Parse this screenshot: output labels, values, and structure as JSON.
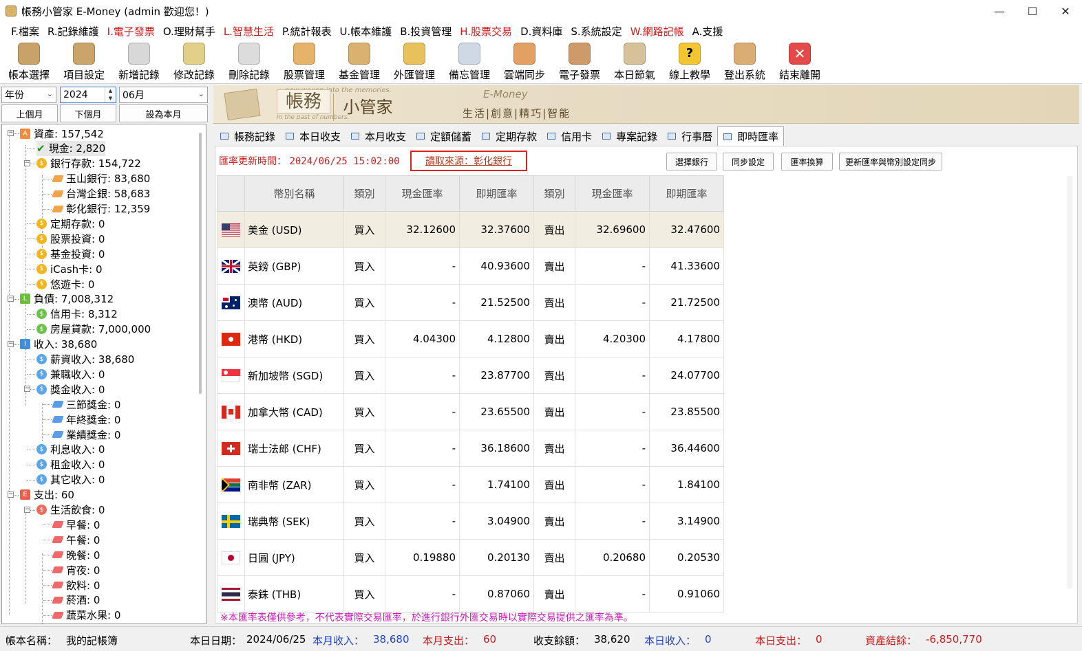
{
  "window": {
    "title": "帳務小管家 E-Money (admin 歡迎您！)"
  },
  "menu": [
    {
      "label": "F.檔案",
      "red": false
    },
    {
      "label": "R.記錄維護",
      "red": false
    },
    {
      "label": "I.電子發票",
      "red": true
    },
    {
      "label": "O.理財幫手",
      "red": false
    },
    {
      "label": "L.智慧生活",
      "red": true
    },
    {
      "label": "P.統計報表",
      "red": false
    },
    {
      "label": "U.帳本維護",
      "red": false
    },
    {
      "label": "B.投資管理",
      "red": false
    },
    {
      "label": "H.股票交易",
      "red": true
    },
    {
      "label": "D.資料庫",
      "red": false
    },
    {
      "label": "S.系統設定",
      "red": false
    },
    {
      "label": "W.網路記帳",
      "red": true
    },
    {
      "label": "A.支援",
      "red": false
    }
  ],
  "toolbar": [
    {
      "label": "帳本選擇",
      "icon": "ledger-book-icon",
      "color": "#c9a26a"
    },
    {
      "label": "項目設定",
      "icon": "settings-gear-icon",
      "color": "#caa56b"
    },
    {
      "label": "新增記錄",
      "icon": "add-record-icon",
      "color": "#d8d8d8"
    },
    {
      "label": "修改記錄",
      "icon": "edit-record-icon",
      "color": "#e2cf8a"
    },
    {
      "label": "刪除記錄",
      "icon": "delete-record-icon",
      "color": "#dcdcdc"
    },
    {
      "label": "股票管理",
      "icon": "stock-chart-icon",
      "color": "#e6b36a"
    },
    {
      "label": "基金管理",
      "icon": "fund-bank-icon",
      "color": "#d9b272"
    },
    {
      "label": "外匯管理",
      "icon": "forex-coin-icon",
      "color": "#e9c15c"
    },
    {
      "label": "備忘管理",
      "icon": "memo-icon",
      "color": "#cfd9e6"
    },
    {
      "label": "雲端同步",
      "icon": "cloud-sync-icon",
      "color": "#e2a062"
    },
    {
      "label": "電子發票",
      "icon": "qr-invoice-icon",
      "color": "#cf9a6a"
    },
    {
      "label": "本日節氣",
      "icon": "solar-term-icon",
      "color": "#d6c29a"
    },
    {
      "label": "線上教學",
      "icon": "help-question-icon",
      "color": "#f2c531"
    },
    {
      "label": "登出系統",
      "icon": "logout-user-icon",
      "color": "#d9ad74"
    },
    {
      "label": "結束離開",
      "icon": "exit-close-icon",
      "color": "#e44a4a"
    }
  ],
  "filter": {
    "period_type": "年份",
    "year": "2024",
    "month": "06月",
    "prev_month": "上個月",
    "next_month": "下個月",
    "this_month": "設為本月"
  },
  "tree": [
    {
      "label": "資產: 157,542",
      "level": 0,
      "kind": "badge",
      "badge": "A",
      "color": "#f08a3c",
      "expanded": true
    },
    {
      "label": "現金: 2,820",
      "level": 1,
      "kind": "check",
      "selected": true
    },
    {
      "label": "銀行存款: 154,722",
      "level": 1,
      "kind": "coin",
      "coin": "$",
      "color": "#f3b51b",
      "expanded": true
    },
    {
      "label": "玉山銀行: 83,680",
      "level": 2,
      "kind": "gem",
      "color": "#f0a54a"
    },
    {
      "label": "台灣企銀: 58,683",
      "level": 2,
      "kind": "gem",
      "color": "#f0a54a"
    },
    {
      "label": "彰化銀行: 12,359",
      "level": 2,
      "kind": "gem",
      "color": "#f0a54a"
    },
    {
      "label": "定期存款: 0",
      "level": 1,
      "kind": "coin",
      "coin": "$",
      "color": "#f3b51b"
    },
    {
      "label": "股票投資: 0",
      "level": 1,
      "kind": "coin",
      "coin": "$",
      "color": "#f3b51b"
    },
    {
      "label": "基金投資: 0",
      "level": 1,
      "kind": "coin",
      "coin": "$",
      "color": "#f3b51b"
    },
    {
      "label": "iCash卡: 0",
      "level": 1,
      "kind": "coin",
      "coin": "$",
      "color": "#f3b51b"
    },
    {
      "label": "悠遊卡: 0",
      "level": 1,
      "kind": "coin",
      "coin": "$",
      "color": "#f3b51b"
    },
    {
      "label": "負債: 7,008,312",
      "level": 0,
      "kind": "badge",
      "badge": "L",
      "color": "#6cbf3a",
      "expanded": true
    },
    {
      "label": "信用卡: 8,312",
      "level": 1,
      "kind": "coin",
      "coin": "$",
      "color": "#6cc24a"
    },
    {
      "label": "房屋貸款: 7,000,000",
      "level": 1,
      "kind": "coin",
      "coin": "$",
      "color": "#6cc24a"
    },
    {
      "label": "收入: 38,680",
      "level": 0,
      "kind": "badge",
      "badge": "I",
      "color": "#3f8fe0",
      "expanded": true
    },
    {
      "label": "薪資收入: 38,680",
      "level": 1,
      "kind": "coin",
      "coin": "$",
      "color": "#5aa6ea"
    },
    {
      "label": "兼職收入: 0",
      "level": 1,
      "kind": "coin",
      "coin": "$",
      "color": "#5aa6ea"
    },
    {
      "label": "獎金收入: 0",
      "level": 1,
      "kind": "coin",
      "coin": "$",
      "color": "#5aa6ea",
      "expanded": true
    },
    {
      "label": "三節獎金: 0",
      "level": 2,
      "kind": "gem",
      "color": "#5a9de6"
    },
    {
      "label": "年終獎金: 0",
      "level": 2,
      "kind": "gem",
      "color": "#5a9de6"
    },
    {
      "label": "業績獎金: 0",
      "level": 2,
      "kind": "gem",
      "color": "#5a9de6"
    },
    {
      "label": "利息收入: 0",
      "level": 1,
      "kind": "coin",
      "coin": "$",
      "color": "#5aa6ea"
    },
    {
      "label": "租金收入: 0",
      "level": 1,
      "kind": "coin",
      "coin": "$",
      "color": "#5aa6ea"
    },
    {
      "label": "其它收入: 0",
      "level": 1,
      "kind": "coin",
      "coin": "$",
      "color": "#5aa6ea"
    },
    {
      "label": "支出: 60",
      "level": 0,
      "kind": "badge",
      "badge": "E",
      "color": "#e8604a",
      "expanded": true
    },
    {
      "label": "生活飲食: 0",
      "level": 1,
      "kind": "coin",
      "coin": "$",
      "color": "#ee6a5a",
      "expanded": true
    },
    {
      "label": "早餐: 0",
      "level": 2,
      "kind": "gem",
      "color": "#ee6a6a"
    },
    {
      "label": "午餐: 0",
      "level": 2,
      "kind": "gem",
      "color": "#ee6a6a"
    },
    {
      "label": "晚餐: 0",
      "level": 2,
      "kind": "gem",
      "color": "#ee6a6a"
    },
    {
      "label": "宵夜: 0",
      "level": 2,
      "kind": "gem",
      "color": "#ee6a6a"
    },
    {
      "label": "飲料: 0",
      "level": 2,
      "kind": "gem",
      "color": "#ee6a6a"
    },
    {
      "label": "菸酒: 0",
      "level": 2,
      "kind": "gem",
      "color": "#ee6a6a"
    },
    {
      "label": "蔬菜水果: 0",
      "level": 2,
      "kind": "gem",
      "color": "#ee6a6a"
    }
  ],
  "banner": {
    "brand_a": "帳務",
    "brand_b": "小管家",
    "tagline_top": "now woven into the memories.",
    "tagline_bottom": "In the past of numbers.",
    "emoney": "E-Money",
    "motto": "生活|創意|精巧|智能"
  },
  "tabs": [
    {
      "label": "帳務記錄",
      "active": false
    },
    {
      "label": "本日收支",
      "active": false
    },
    {
      "label": "本月收支",
      "active": false
    },
    {
      "label": "定額儲蓄",
      "active": false
    },
    {
      "label": "定期存款",
      "active": false
    },
    {
      "label": "信用卡",
      "active": false
    },
    {
      "label": "專案記錄",
      "active": false
    },
    {
      "label": "行事曆",
      "active": false
    },
    {
      "label": "即時匯率",
      "active": true
    }
  ],
  "rates": {
    "update_label": "匯率更新時間：",
    "update_time": "2024/06/25 15:02:00",
    "source": "讀取來源：彰化銀行",
    "buttons": [
      "選擇銀行",
      "同步設定",
      "匯率換算",
      "更新匯率與幣別設定同步"
    ],
    "headers": [
      "",
      "幣別名稱",
      "類別",
      "現金匯率",
      "即期匯率",
      "類別",
      "現金匯率",
      "即期匯率"
    ],
    "rows": [
      {
        "flag": "us",
        "name": "美金 (USD)",
        "buy_type": "買入",
        "buy_cash": "32.12600",
        "buy_spot": "32.37600",
        "sell_type": "賣出",
        "sell_cash": "32.69600",
        "sell_spot": "32.47600"
      },
      {
        "flag": "gb",
        "name": "英鎊 (GBP)",
        "buy_type": "買入",
        "buy_cash": "-",
        "buy_spot": "40.93600",
        "sell_type": "賣出",
        "sell_cash": "-",
        "sell_spot": "41.33600"
      },
      {
        "flag": "au",
        "name": "澳幣 (AUD)",
        "buy_type": "買入",
        "buy_cash": "-",
        "buy_spot": "21.52500",
        "sell_type": "賣出",
        "sell_cash": "-",
        "sell_spot": "21.72500"
      },
      {
        "flag": "hk",
        "name": "港幣 (HKD)",
        "buy_type": "買入",
        "buy_cash": "4.04300",
        "buy_spot": "4.12800",
        "sell_type": "賣出",
        "sell_cash": "4.20300",
        "sell_spot": "4.17800"
      },
      {
        "flag": "sg",
        "name": "新加坡幣 (SGD)",
        "buy_type": "買入",
        "buy_cash": "-",
        "buy_spot": "23.87700",
        "sell_type": "賣出",
        "sell_cash": "-",
        "sell_spot": "24.07700"
      },
      {
        "flag": "ca",
        "name": "加拿大幣 (CAD)",
        "buy_type": "買入",
        "buy_cash": "-",
        "buy_spot": "23.65500",
        "sell_type": "賣出",
        "sell_cash": "-",
        "sell_spot": "23.85500"
      },
      {
        "flag": "ch",
        "name": "瑞士法郎 (CHF)",
        "buy_type": "買入",
        "buy_cash": "-",
        "buy_spot": "36.18600",
        "sell_type": "賣出",
        "sell_cash": "-",
        "sell_spot": "36.44600"
      },
      {
        "flag": "za",
        "name": "南非幣 (ZAR)",
        "buy_type": "買入",
        "buy_cash": "-",
        "buy_spot": "1.74100",
        "sell_type": "賣出",
        "sell_cash": "-",
        "sell_spot": "1.84100"
      },
      {
        "flag": "se",
        "name": "瑞典幣 (SEK)",
        "buy_type": "買入",
        "buy_cash": "-",
        "buy_spot": "3.04900",
        "sell_type": "賣出",
        "sell_cash": "-",
        "sell_spot": "3.14900"
      },
      {
        "flag": "jp",
        "name": "日圓 (JPY)",
        "buy_type": "買入",
        "buy_cash": "0.19880",
        "buy_spot": "0.20130",
        "sell_type": "賣出",
        "sell_cash": "0.20680",
        "sell_spot": "0.20530"
      },
      {
        "flag": "th",
        "name": "泰銖 (THB)",
        "buy_type": "買入",
        "buy_cash": "-",
        "buy_spot": "0.87060",
        "sell_type": "賣出",
        "sell_cash": "-",
        "sell_spot": "0.91060"
      }
    ],
    "note": "※本匯率表僅供參考，不代表實際交易匯率，於進行銀行外匯交易時以實際交易提供之匯率為準。"
  },
  "status": {
    "ledger_label": "帳本名稱：",
    "ledger_value": "我的記帳簿",
    "date_label": "本日日期：",
    "date_value": "2024/06/25",
    "month_income_label": "本月收入：",
    "month_income_value": "38,680",
    "month_expense_label": "本月支出：",
    "month_expense_value": "60",
    "balance_label": "收支餘額：",
    "balance_value": "38,620",
    "day_income_label": "本日收入：",
    "day_income_value": "0",
    "day_expense_label": "本日支出：",
    "day_expense_value": "0",
    "net_assets_label": "資產結餘：",
    "net_assets_value": "-6,850,770"
  }
}
